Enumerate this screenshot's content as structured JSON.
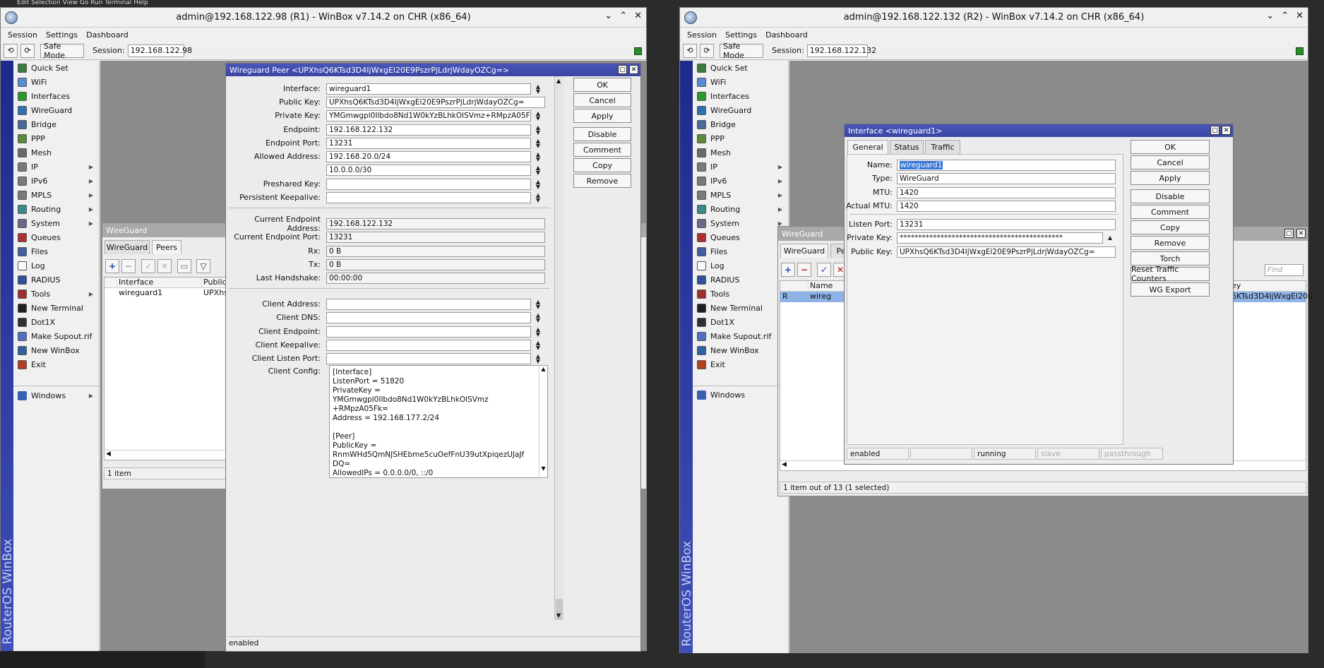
{
  "bg_text": "Edit Selection View Go Run Terminal Help",
  "left": {
    "title": "admin@192.168.122.98 (R1) - WinBox v7.14.2 on CHR (x86_64)",
    "menu": [
      "Session",
      "Settings",
      "Dashboard"
    ],
    "safe_mode": "Safe Mode",
    "session_label": "Session:",
    "session_value": "192.168.122.98",
    "vbar": "RouterOS WinBox",
    "sidebar": [
      {
        "label": "Quick Set",
        "icon": "quickset-icon",
        "color": "#3a7a3a"
      },
      {
        "label": "WiFi",
        "icon": "wifi-icon",
        "color": "#5a8ad0"
      },
      {
        "label": "Interfaces",
        "icon": "interfaces-icon",
        "color": "#2a9a2a"
      },
      {
        "label": "WireGuard",
        "icon": "wireguard-icon",
        "color": "#3070b0"
      },
      {
        "label": "Bridge",
        "icon": "bridge-icon",
        "color": "#4a6a9a"
      },
      {
        "label": "PPP",
        "icon": "ppp-icon",
        "color": "#5a8a3a"
      },
      {
        "label": "Mesh",
        "icon": "mesh-icon",
        "color": "#6a6a6a"
      },
      {
        "label": "IP",
        "icon": "ip-icon",
        "color": "#7a7a7a",
        "arrow": true
      },
      {
        "label": "IPv6",
        "icon": "ipv6-icon",
        "color": "#7a7a7a",
        "arrow": true
      },
      {
        "label": "MPLS",
        "icon": "mpls-icon",
        "color": "#7a7a7a",
        "arrow": true
      },
      {
        "label": "Routing",
        "icon": "routing-icon",
        "color": "#3a8a8a",
        "arrow": true
      },
      {
        "label": "System",
        "icon": "system-icon",
        "color": "#6a6a8a",
        "arrow": true
      },
      {
        "label": "Queues",
        "icon": "queues-icon",
        "color": "#b03030"
      },
      {
        "label": "Files",
        "icon": "files-icon",
        "color": "#4060a0"
      },
      {
        "label": "Log",
        "icon": "log-icon",
        "color": "#fafafa"
      },
      {
        "label": "RADIUS",
        "icon": "radius-icon",
        "color": "#3050a0"
      },
      {
        "label": "Tools",
        "icon": "tools-icon",
        "color": "#a03030",
        "arrow": true
      },
      {
        "label": "New Terminal",
        "icon": "terminal-icon",
        "color": "#202020"
      },
      {
        "label": "Dot1X",
        "icon": "dot1x-icon",
        "color": "#303030"
      },
      {
        "label": "Make Supout.rif",
        "icon": "supout-icon",
        "color": "#5070c0"
      },
      {
        "label": "New WinBox",
        "icon": "newwinbox-icon",
        "color": "#3060a0"
      },
      {
        "label": "Exit",
        "icon": "exit-icon",
        "color": "#b04020"
      }
    ],
    "windows_label": "Windows",
    "wg_list": {
      "title": "WireGuard",
      "tabs": [
        "WireGuard",
        "Peers"
      ],
      "columns": [
        "Interface",
        "Public"
      ],
      "rows": [
        [
          "wireguard1",
          "UPXhs"
        ]
      ],
      "count": "1 item"
    },
    "peer": {
      "title": "Wireguard Peer <UPXhsQ6KTsd3D4IjWxgEl20E9PszrPjLdrjWdayOZCg=>",
      "fields": [
        {
          "label": "Interface:",
          "value": "wireguard1"
        },
        {
          "label": "Public Key:",
          "value": "UPXhsQ6KTsd3D4IjWxgEl20E9PszrPjLdrjWdayOZCg="
        },
        {
          "label": "Private Key:",
          "value": "YMGmwgpl0Ilbdo8Nd1W0kYzBLhkOlSVmz+RMpzA05Fk="
        },
        {
          "label": "Endpoint:",
          "value": "192.168.122.132"
        },
        {
          "label": "Endpoint Port:",
          "value": "13231"
        },
        {
          "label": "Allowed Address:",
          "value": "192.168.20.0/24"
        },
        {
          "label": "",
          "value": "10.0.0.0/30"
        },
        {
          "label": "Preshared Key:",
          "value": ""
        },
        {
          "label": "Persistent Keepalive:",
          "value": ""
        }
      ],
      "status_fields": [
        {
          "label": "Current Endpoint Address:",
          "value": "192.168.122.132"
        },
        {
          "label": "Current Endpoint Port:",
          "value": "13231"
        },
        {
          "label": "Rx:",
          "value": "0 B"
        },
        {
          "label": "Tx:",
          "value": "0 B"
        },
        {
          "label": "Last Handshake:",
          "value": "00:00:00"
        }
      ],
      "client_fields": [
        {
          "label": "Client Address:",
          "value": ""
        },
        {
          "label": "Client DNS:",
          "value": ""
        },
        {
          "label": "Client Endpoint:",
          "value": ""
        },
        {
          "label": "Client Keepalive:",
          "value": ""
        },
        {
          "label": "Client Listen Port:",
          "value": ""
        }
      ],
      "client_config_label": "Client Config:",
      "client_config": "[Interface]\nListenPort = 51820\nPrivateKey =\nYMGmwgpl0Ilbdo8Nd1W0kYzBLhkOlSVmz\n+RMpzA05Fk=\nAddress = 192.168.177.2/24\n\n[Peer]\nPublicKey =\nRnmWHd5QmNJSHEbme5cuOefFnU39utXpiqezUJaJf\nDQ=\nAllowedIPs = 0.0.0.0/0, ::/0",
      "buttons": [
        "OK",
        "Cancel",
        "Apply",
        "Disable",
        "Comment",
        "Copy",
        "Remove"
      ],
      "status": "enabled"
    }
  },
  "right": {
    "title": "admin@192.168.122.132 (R2) - WinBox v7.14.2 on CHR (x86_64)",
    "menu": [
      "Session",
      "Settings",
      "Dashboard"
    ],
    "safe_mode": "Safe Mode",
    "session_label": "Session:",
    "session_value": "192.168.122.132",
    "vbar": "RouterOS WinBox",
    "windows_label": "Windows",
    "wg_list": {
      "title": "WireGuard",
      "tabs": [
        "WireGuard",
        "Pe"
      ],
      "find_placeholder": "Find",
      "col_name": "Name",
      "col_key": "ey",
      "row_flag": "R",
      "row_name": "wireg",
      "row_key": "6KTsd3D4IjWxgEl20E",
      "count": "1 item out of 13 (1 selected)"
    },
    "iface": {
      "title": "Interface <wireguard1>",
      "tabs": [
        "General",
        "Status",
        "Traffic"
      ],
      "fields": [
        {
          "label": "Name:",
          "value": "wireguard1"
        },
        {
          "label": "Type:",
          "value": "WireGuard"
        },
        {
          "label": "MTU:",
          "value": "1420"
        },
        {
          "label": "Actual MTU:",
          "value": "1420"
        }
      ],
      "fields2": [
        {
          "label": "Listen Port:",
          "value": "13231"
        },
        {
          "label": "Private Key:",
          "value": "********************************************"
        },
        {
          "label": "Public Key:",
          "value": "UPXhsQ6KTsd3D4IjWxgEl20E9PszrPjLdrjWdayOZCg="
        }
      ],
      "buttons": [
        "OK",
        "Cancel",
        "Apply",
        "Disable",
        "Comment",
        "Copy",
        "Remove",
        "Torch",
        "Reset Traffic Counters",
        "WG Export"
      ],
      "status": [
        "enabled",
        "",
        "running",
        "slave",
        "passthrough"
      ]
    }
  }
}
